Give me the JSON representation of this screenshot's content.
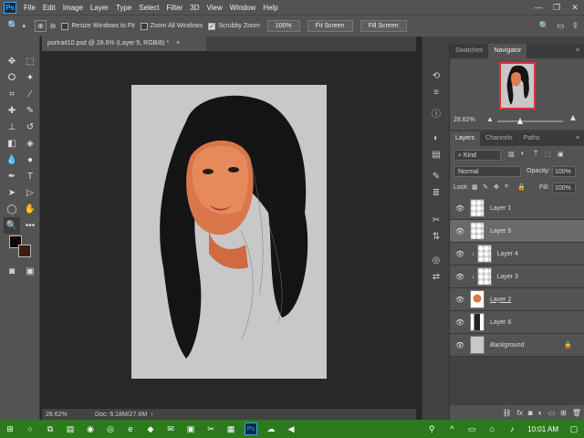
{
  "app": {
    "logo": "Ps",
    "doc_title": "portrait10.psd @ 28.6% (Layer 5, RGB/8) *"
  },
  "menu": [
    "File",
    "Edit",
    "Image",
    "Layer",
    "Type",
    "Select",
    "Filter",
    "3D",
    "View",
    "Window",
    "Help"
  ],
  "options": {
    "resize_windows": "Resize Windows to Fit",
    "zoom_all": "Zoom All Windows",
    "scrubby": "Scrubby Zoom",
    "zoom_pct": "100%",
    "fit": "Fit Screen",
    "fill": "Fill Screen"
  },
  "status": {
    "zoom": "28.62%",
    "doc": "Doc: 6.18M/27.6M"
  },
  "navigator": {
    "tabs": [
      "Swatches",
      "Navigator"
    ],
    "zoom": "28.62%"
  },
  "layers_panel": {
    "tabs": [
      "Layers",
      "Channels",
      "Paths"
    ],
    "kind": "Kind",
    "blend": "Normal",
    "opacity_label": "Opacity:",
    "opacity": "100%",
    "lock_label": "Lock:",
    "fill_label": "Fill:",
    "fill": "100%",
    "layers": [
      {
        "name": "Layer 1"
      },
      {
        "name": "Layer 5"
      },
      {
        "name": "Layer 4"
      },
      {
        "name": "Layer 3"
      },
      {
        "name": "Layer 2"
      },
      {
        "name": "Layer 6"
      },
      {
        "name": "Background"
      }
    ]
  },
  "taskbar": {
    "time": "10:01 AM"
  }
}
